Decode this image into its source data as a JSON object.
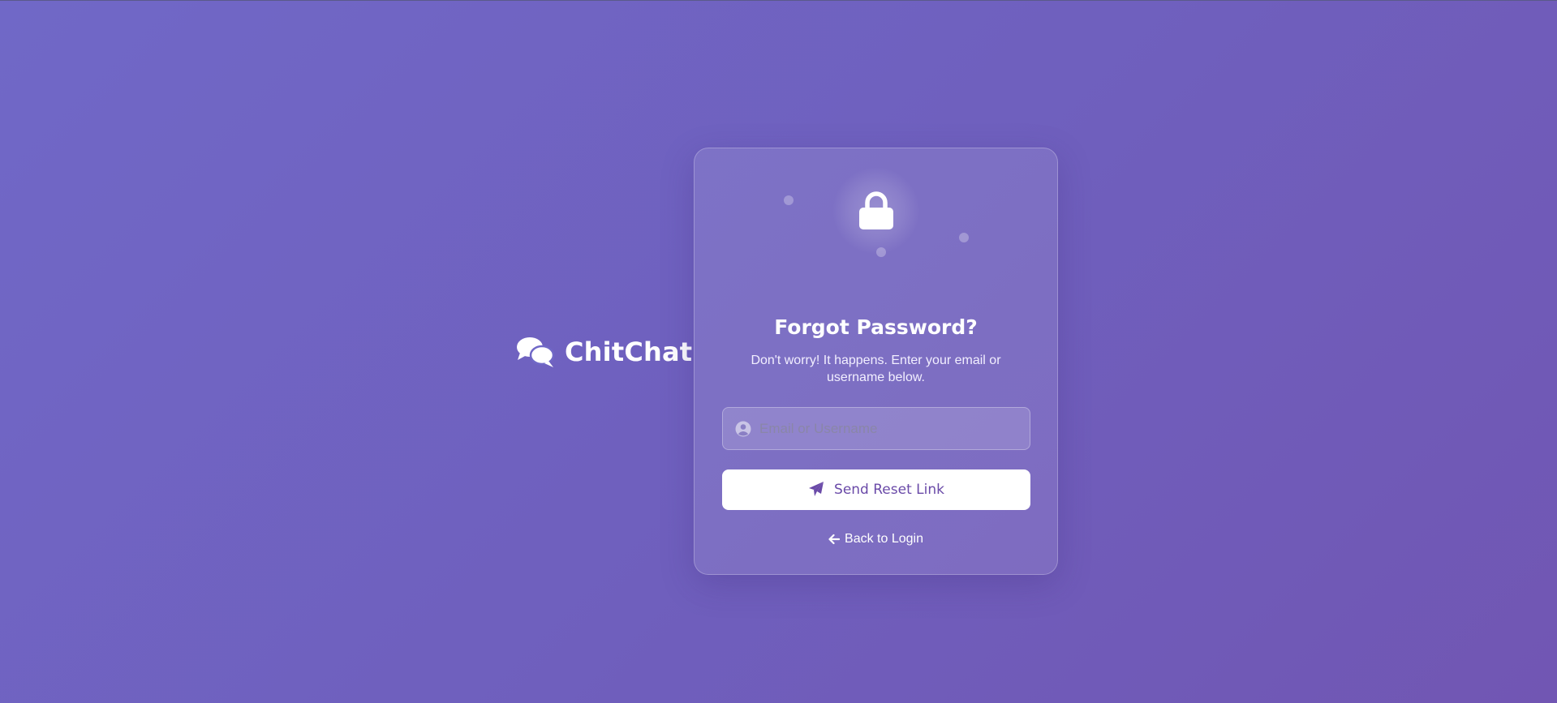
{
  "brand": {
    "name": "ChitChat",
    "icon": "comments-icon"
  },
  "card": {
    "icon": "lock-icon",
    "title": "Forgot Password?",
    "subtitle": "Don't worry! It happens. Enter your email or username below.",
    "input": {
      "icon": "user-circle-icon",
      "placeholder": "Email or Username",
      "value": ""
    },
    "submit": {
      "icon": "paper-plane-icon",
      "label": "Send Reset Link"
    },
    "back_link": {
      "icon": "arrow-left-icon",
      "label": "Back to Login"
    }
  },
  "colors": {
    "background_start": "#7068c7",
    "background_end": "#7156b3",
    "button_text": "#6a4aa8",
    "button_bg": "#ffffff"
  }
}
